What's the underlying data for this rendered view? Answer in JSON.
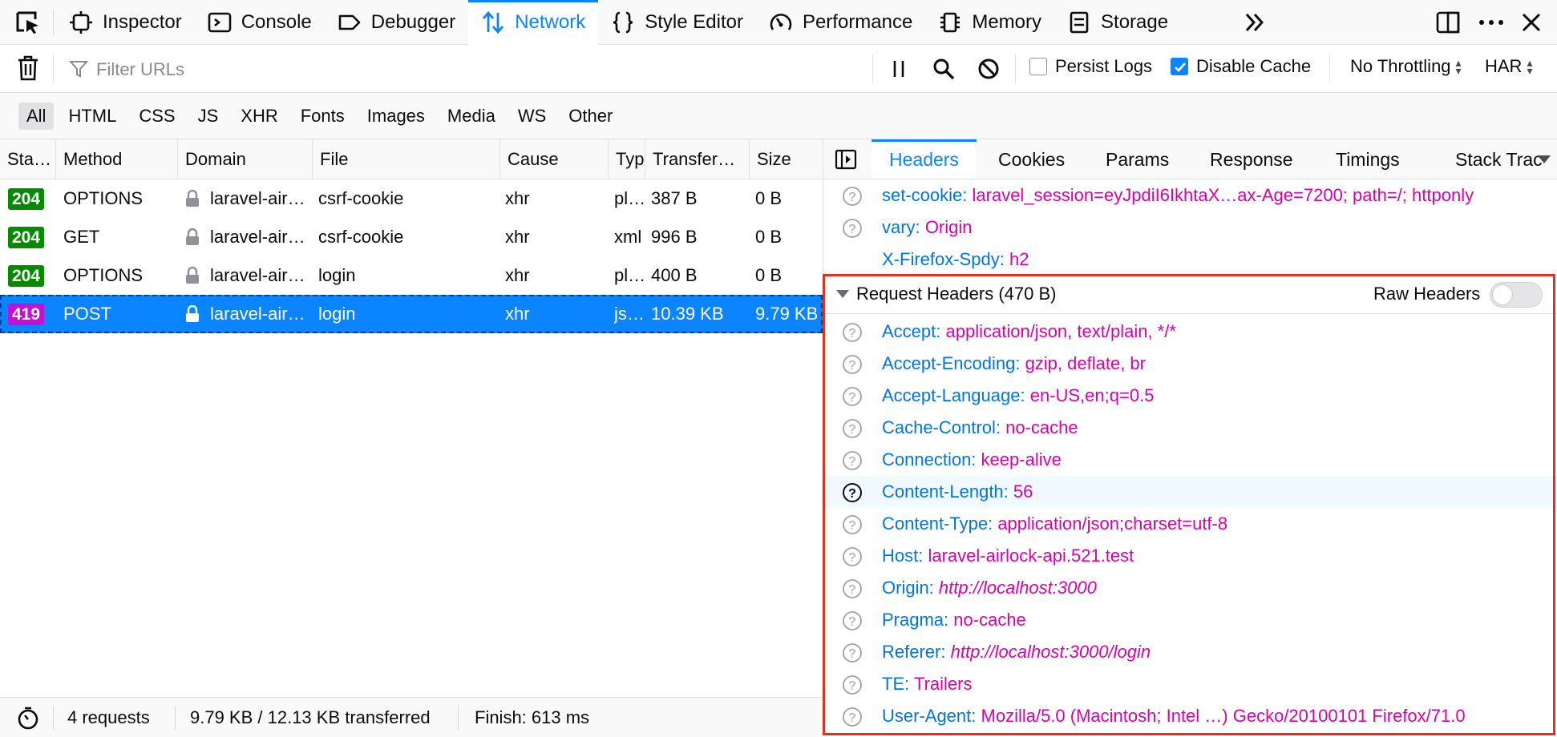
{
  "toolbar": {
    "tabs": [
      {
        "label": "Inspector",
        "icon": "inspector-icon"
      },
      {
        "label": "Console",
        "icon": "console-icon"
      },
      {
        "label": "Debugger",
        "icon": "debugger-icon"
      },
      {
        "label": "Network",
        "icon": "network-icon",
        "active": true
      },
      {
        "label": "Style Editor",
        "icon": "style-editor-icon"
      },
      {
        "label": "Performance",
        "icon": "performance-icon"
      },
      {
        "label": "Memory",
        "icon": "memory-icon"
      },
      {
        "label": "Storage",
        "icon": "storage-icon"
      }
    ],
    "accent_color": "#0a84ff"
  },
  "filterbar": {
    "placeholder": "Filter URLs",
    "persist_logs_label": "Persist Logs",
    "persist_logs_checked": false,
    "disable_cache_label": "Disable Cache",
    "disable_cache_checked": true,
    "throttling": "No Throttling",
    "har": "HAR"
  },
  "type_filters": [
    "All",
    "HTML",
    "CSS",
    "JS",
    "XHR",
    "Fonts",
    "Images",
    "Media",
    "WS",
    "Other"
  ],
  "requests": {
    "columns": [
      "Sta…",
      "Method",
      "Domain",
      "File",
      "Cause",
      "Typ",
      "Transfer…",
      "Size"
    ],
    "rows": [
      {
        "status": "204",
        "method": "OPTIONS",
        "domain": "laravel-air…",
        "file": "csrf-cookie",
        "cause": "xhr",
        "type": "pl…",
        "transferred": "387 B",
        "size": "0 B"
      },
      {
        "status": "204",
        "method": "GET",
        "domain": "laravel-air…",
        "file": "csrf-cookie",
        "cause": "xhr",
        "type": "xml",
        "transferred": "996 B",
        "size": "0 B"
      },
      {
        "status": "204",
        "method": "OPTIONS",
        "domain": "laravel-air…",
        "file": "login",
        "cause": "xhr",
        "type": "pl…",
        "transferred": "400 B",
        "size": "0 B"
      },
      {
        "status": "419",
        "method": "POST",
        "domain": "laravel-air…",
        "file": "login",
        "cause": "xhr",
        "type": "js…",
        "transferred": "10.39 KB",
        "size": "9.79 KB",
        "selected": true
      }
    ]
  },
  "statusbar": {
    "requests": "4 requests",
    "transferred": "9.79 KB / 12.13 KB transferred",
    "finish": "Finish: 613 ms"
  },
  "side": {
    "tabs": [
      "Headers",
      "Cookies",
      "Params",
      "Response",
      "Timings",
      "Stack Trac"
    ],
    "response_headers_tail": [
      {
        "name": "set-cookie:",
        "value": "laravel_session=eyJpdiI6IkhtaX…ax-Age=7200; path=/; httponly"
      },
      {
        "name": "vary:",
        "value": "Origin"
      },
      {
        "name": "X-Firefox-Spdy:",
        "value": "h2"
      }
    ],
    "request_headers_title": "Request Headers (470 B)",
    "raw_headers_label": "Raw Headers",
    "raw_headers_on": false,
    "request_headers": [
      {
        "name": "Accept:",
        "value": "application/json, text/plain, */*"
      },
      {
        "name": "Accept-Encoding:",
        "value": "gzip, deflate, br"
      },
      {
        "name": "Accept-Language:",
        "value": "en-US,en;q=0.5"
      },
      {
        "name": "Cache-Control:",
        "value": "no-cache"
      },
      {
        "name": "Connection:",
        "value": "keep-alive"
      },
      {
        "name": "Content-Length:",
        "value": "56"
      },
      {
        "name": "Content-Type:",
        "value": "application/json;charset=utf-8"
      },
      {
        "name": "Host:",
        "value": "laravel-airlock-api.521.test"
      },
      {
        "name": "Origin:",
        "value": "http://localhost:3000"
      },
      {
        "name": "Pragma:",
        "value": "no-cache"
      },
      {
        "name": "Referer:",
        "value": "http://localhost:3000/login"
      },
      {
        "name": "TE:",
        "value": "Trailers"
      },
      {
        "name": "User-Agent:",
        "value": "Mozilla/5.0 (Macintosh; Intel …) Gecko/20100101 Firefox/71.0"
      }
    ]
  },
  "colors": {
    "status_ok": "#058b00",
    "status_error": "#c50ed8",
    "header_name": "#0074e8",
    "header_value": "#dd00a9",
    "highlight_border": "#e0331d"
  }
}
